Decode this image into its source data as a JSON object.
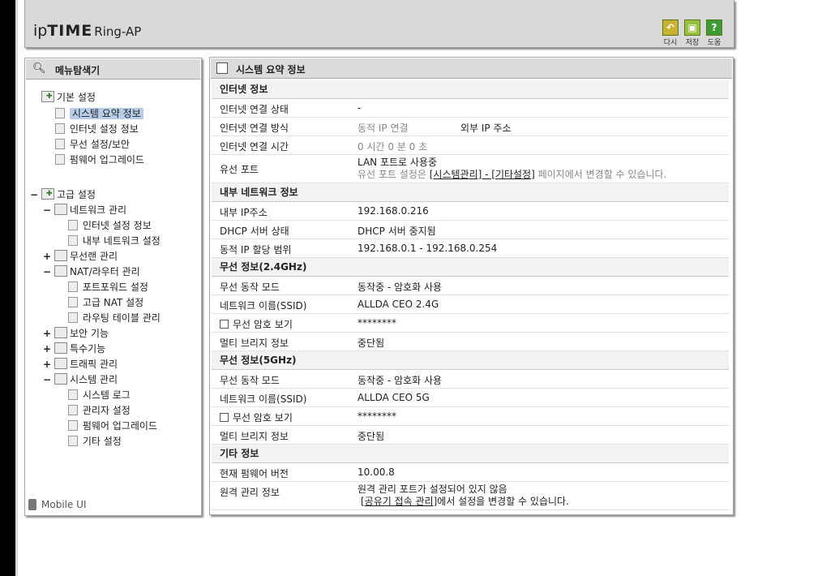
{
  "header": {
    "logo_ip": "ip",
    "logo_time": "TIME",
    "logo_model": "Ring-AP",
    "buttons": [
      {
        "label": "다시",
        "icon": "refresh-icon",
        "color": "#b7a32a"
      },
      {
        "label": "저장",
        "icon": "save-icon",
        "color": "#8aae2e"
      },
      {
        "label": "도움",
        "icon": "help-icon",
        "color": "#3e8e2e"
      }
    ]
  },
  "sidebar": {
    "title": "메뉴탐색기",
    "basic": {
      "label": "기본 설정",
      "items": [
        "시스템 요약 정보",
        "인터넷 설정 정보",
        "무선 설정/보안",
        "펌웨어 업그레이드"
      ]
    },
    "advanced": {
      "label": "고급 설정",
      "network": {
        "label": "네트워크 관리",
        "items": [
          "인터넷 설정 정보",
          "내부 네트워크 설정"
        ]
      },
      "wireless": "무선랜 관리",
      "nat": {
        "label": "NAT/라우터 관리",
        "items": [
          "포트포워드 설정",
          "고급 NAT 설정",
          "라우팅 테이블 관리"
        ]
      },
      "security": "보안 기능",
      "special": "특수기능",
      "traffic": "트래픽 관리",
      "system": {
        "label": "시스템 관리",
        "items": [
          "시스템 로그",
          "관리자 설정",
          "펌웨어 업그레이드",
          "기타 설정"
        ]
      }
    },
    "mobile": "Mobile UI"
  },
  "main": {
    "title": "시스템 요약 정보",
    "internet": {
      "section": "인터넷 정보",
      "status_label": "인터넷 연결 상태",
      "status_value": "-",
      "method_label": "인터넷 연결 방식",
      "method_value": "동적 IP 연결",
      "method_extra": "외부 IP 주소",
      "time_label": "인터넷 연결 시간",
      "time_value": "0 시간 0 분 0 초",
      "wired_label": "유선 포트",
      "wired_value": "LAN 포트로 사용중",
      "wired_note_pre": "유선 포트 설정은 ",
      "wired_note_link": "[시스템관리] - [기타설정]",
      "wired_note_post": " 페이지에서 변경할 수 있습니다."
    },
    "lan": {
      "section": "내부 네트워크 정보",
      "ip_label": "내부 IP주소",
      "ip_value": "192.168.0.216",
      "dhcp_label": "DHCP 서버 상태",
      "dhcp_value": "DHCP 서버 중지됨",
      "range_label": "동적 IP 할당 범위",
      "range_value": "192.168.0.1 -  192.168.0.254"
    },
    "wifi24": {
      "section": "무선 정보(2.4GHz)",
      "mode_label": "무선 동작 모드",
      "mode_value": "동작중 - 암호화 사용",
      "ssid_label": "네트워크 이름(SSID)",
      "ssid_value": "ALLDA CEO 2.4G",
      "pw_label": "무선 암호 보기",
      "pw_value": "********",
      "bridge_label": "멀티 브리지 정보",
      "bridge_value": "중단됨"
    },
    "wifi5": {
      "section": "무선 정보(5GHz)",
      "mode_label": "무선 동작 모드",
      "mode_value": "동작중 - 암호화 사용",
      "ssid_label": "네트워크 이름(SSID)",
      "ssid_value": "ALLDA CEO 5G",
      "pw_label": "무선 암호 보기",
      "pw_value": "********",
      "bridge_label": "멀티 브리지 정보",
      "bridge_value": "중단됨"
    },
    "etc": {
      "section": "기타 정보",
      "fw_label": "현재 펌웨어 버전",
      "fw_value": "10.00.8",
      "remote_label": "원격 관리 정보",
      "remote_value": "원격 관리 포트가 설정되어 있지 않음",
      "remote_note_link": "[공유기 접속 관리]",
      "remote_note_post": "에서 설정을 변경할 수 있습니다."
    }
  }
}
